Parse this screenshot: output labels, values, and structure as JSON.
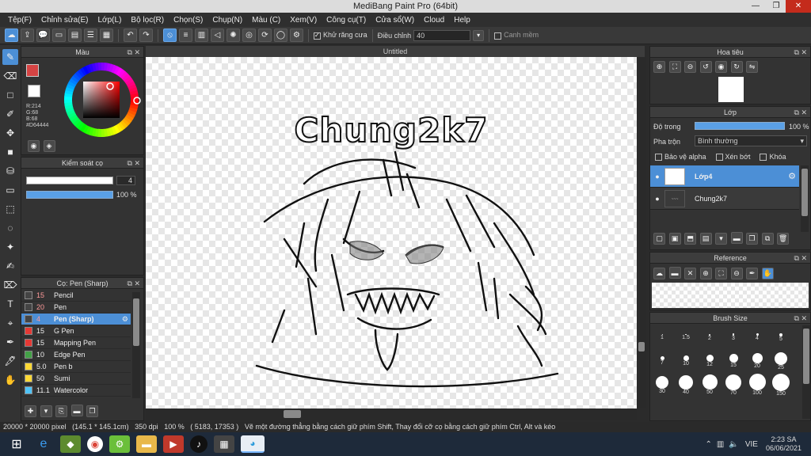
{
  "window": {
    "title": "MediBang Paint Pro (64bit)"
  },
  "menu": [
    "Tệp(F)",
    "Chỉnh sửa(E)",
    "Lớp(L)",
    "Bộ lọc(R)",
    "Chọn(S)",
    "Chụp(N)",
    "Màu (C)",
    "Xem(V)",
    "Công cụ(T)",
    "Cửa sổ(W)",
    "Cloud",
    "Help"
  ],
  "toolbar": {
    "antialias_label": "Khử răng cưa",
    "antialias_on": true,
    "adjust_label": "Điều chỉnh",
    "adjust_value": "40",
    "snap_label": "Canh mềm"
  },
  "color_panel": {
    "title": "Màu",
    "r": "R:214",
    "g": "G:68",
    "b": "B:68",
    "hex": "#D64444",
    "fg_color": "#D64444"
  },
  "brush_control": {
    "title": "Kiểm soát cọ",
    "size": "4",
    "opacity": "100 %"
  },
  "brush_list": {
    "title": "Cọ: Pen (Sharp)",
    "items": [
      {
        "size": "15",
        "name": "Pencil",
        "color": "#444444"
      },
      {
        "size": "20",
        "name": "Pen",
        "color": "#444444"
      },
      {
        "size": "4",
        "name": "Pen (Sharp)",
        "color": "#444444"
      },
      {
        "size": "15",
        "name": "G Pen",
        "color": "#e53935"
      },
      {
        "size": "15",
        "name": "Mapping Pen",
        "color": "#e53935"
      },
      {
        "size": "10",
        "name": "Edge Pen",
        "color": "#43a047"
      },
      {
        "size": "5.0",
        "name": "Pen b",
        "color": "#fdd835"
      },
      {
        "size": "50",
        "name": "Sumi",
        "color": "#fdd835"
      },
      {
        "size": "11.1",
        "name": "Watercolor",
        "color": "#4fc3f7"
      }
    ]
  },
  "canvas": {
    "tab_title": "Untitled",
    "drawing_text": "Chung2k7"
  },
  "navigator": {
    "title": "Hoa tiêu"
  },
  "layers": {
    "title": "Lớp",
    "opacity_label": "Độ trong",
    "opacity_value": "100 %",
    "blend_label": "Pha trộn",
    "blend_value": "Bình thường",
    "protect_alpha": "Bảo vệ alpha",
    "clipping": "Xén bớt",
    "lock": "Khóa",
    "items": [
      {
        "name": "Lớp4"
      },
      {
        "name": "Chung2k7"
      }
    ]
  },
  "reference": {
    "title": "Reference"
  },
  "brush_size": {
    "title": "Brush Size",
    "sizes": [
      "1",
      "1.5",
      "2",
      "3",
      "4",
      "5",
      "7",
      "10",
      "12",
      "15",
      "20",
      "25",
      "30",
      "40",
      "50",
      "70",
      "100",
      "150"
    ]
  },
  "status": {
    "size": "20000 * 20000 pixel",
    "cm": "(145.1 * 145.1cm)",
    "dpi": "350 dpi",
    "zoom": "100 %",
    "coords": "( 5183, 17353 )",
    "hint": "Vẽ một đường thẳng bằng cách giữ phím Shift, Thay đổi cỡ cọ bằng cách giữ phím Ctrl, Alt và kéo"
  },
  "taskbar": {
    "lang": "VIE",
    "time": "2:23 SA",
    "date": "06/06/2021"
  },
  "icons": {
    "win": "windows-logo-icon",
    "ie": "internet-explorer-icon"
  }
}
